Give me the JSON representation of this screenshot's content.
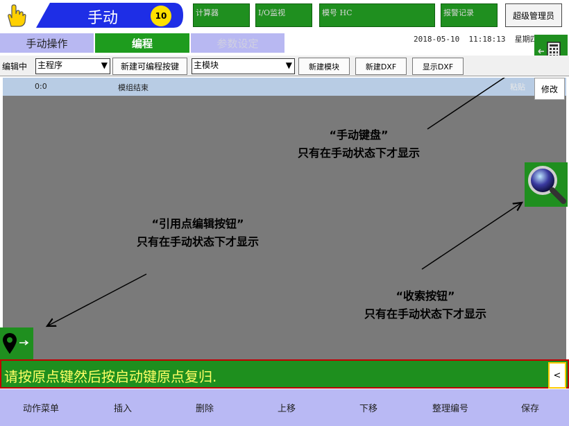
{
  "header": {
    "mode_label": "手动",
    "speed_value": "10",
    "buttons": [
      "计算器",
      "I/O监视",
      "模号 HC",
      "报警记录"
    ],
    "user_button": "超级管理员"
  },
  "tabs": {
    "manual": "手动操作",
    "program": "编程",
    "params": "参数设定"
  },
  "datetime": {
    "date": "2018-05-10",
    "time": "11:18:13",
    "weekday": "星期四"
  },
  "toolbar": {
    "editing_label": "编辑中",
    "program_select": "主程序",
    "new_prog_key": "新建可编程按键",
    "module_select": "主模块",
    "new_module": "新建模块",
    "new_dxf": "新建DXF",
    "show_dxf": "显示DXF"
  },
  "program_list": {
    "rows": [
      {
        "index": "0:0",
        "text": "模组结束"
      }
    ],
    "paste_label": "粘贴",
    "modify_label": "修改"
  },
  "annotations": {
    "keyboard": {
      "title": "“手动键盘”",
      "desc": "只有在手动状态下才显示"
    },
    "refpoint": {
      "title": "“引用点编辑按钮”",
      "desc": "只有在手动状态下才显示"
    },
    "search": {
      "title": "“收索按钮”",
      "desc": "只有在手动状态下才显示"
    }
  },
  "status": {
    "message": "请按原点键然后按启动键原点复归.",
    "collapse_icon": "<"
  },
  "bottom_buttons": [
    "动作菜单",
    "插入",
    "删除",
    "上移",
    "下移",
    "整理编号",
    "保存"
  ],
  "icons": {
    "hand": "hand-pointer-icon",
    "keyboard": "keyboard-icon",
    "search": "magnifier-icon",
    "location": "location-pin-icon"
  },
  "colors": {
    "green": "#1f8f1f",
    "tab_blue": "#b8b8f2",
    "mode_blue": "#1e2ee6",
    "status_text": "#ffff66",
    "status_border": "#c00000"
  }
}
